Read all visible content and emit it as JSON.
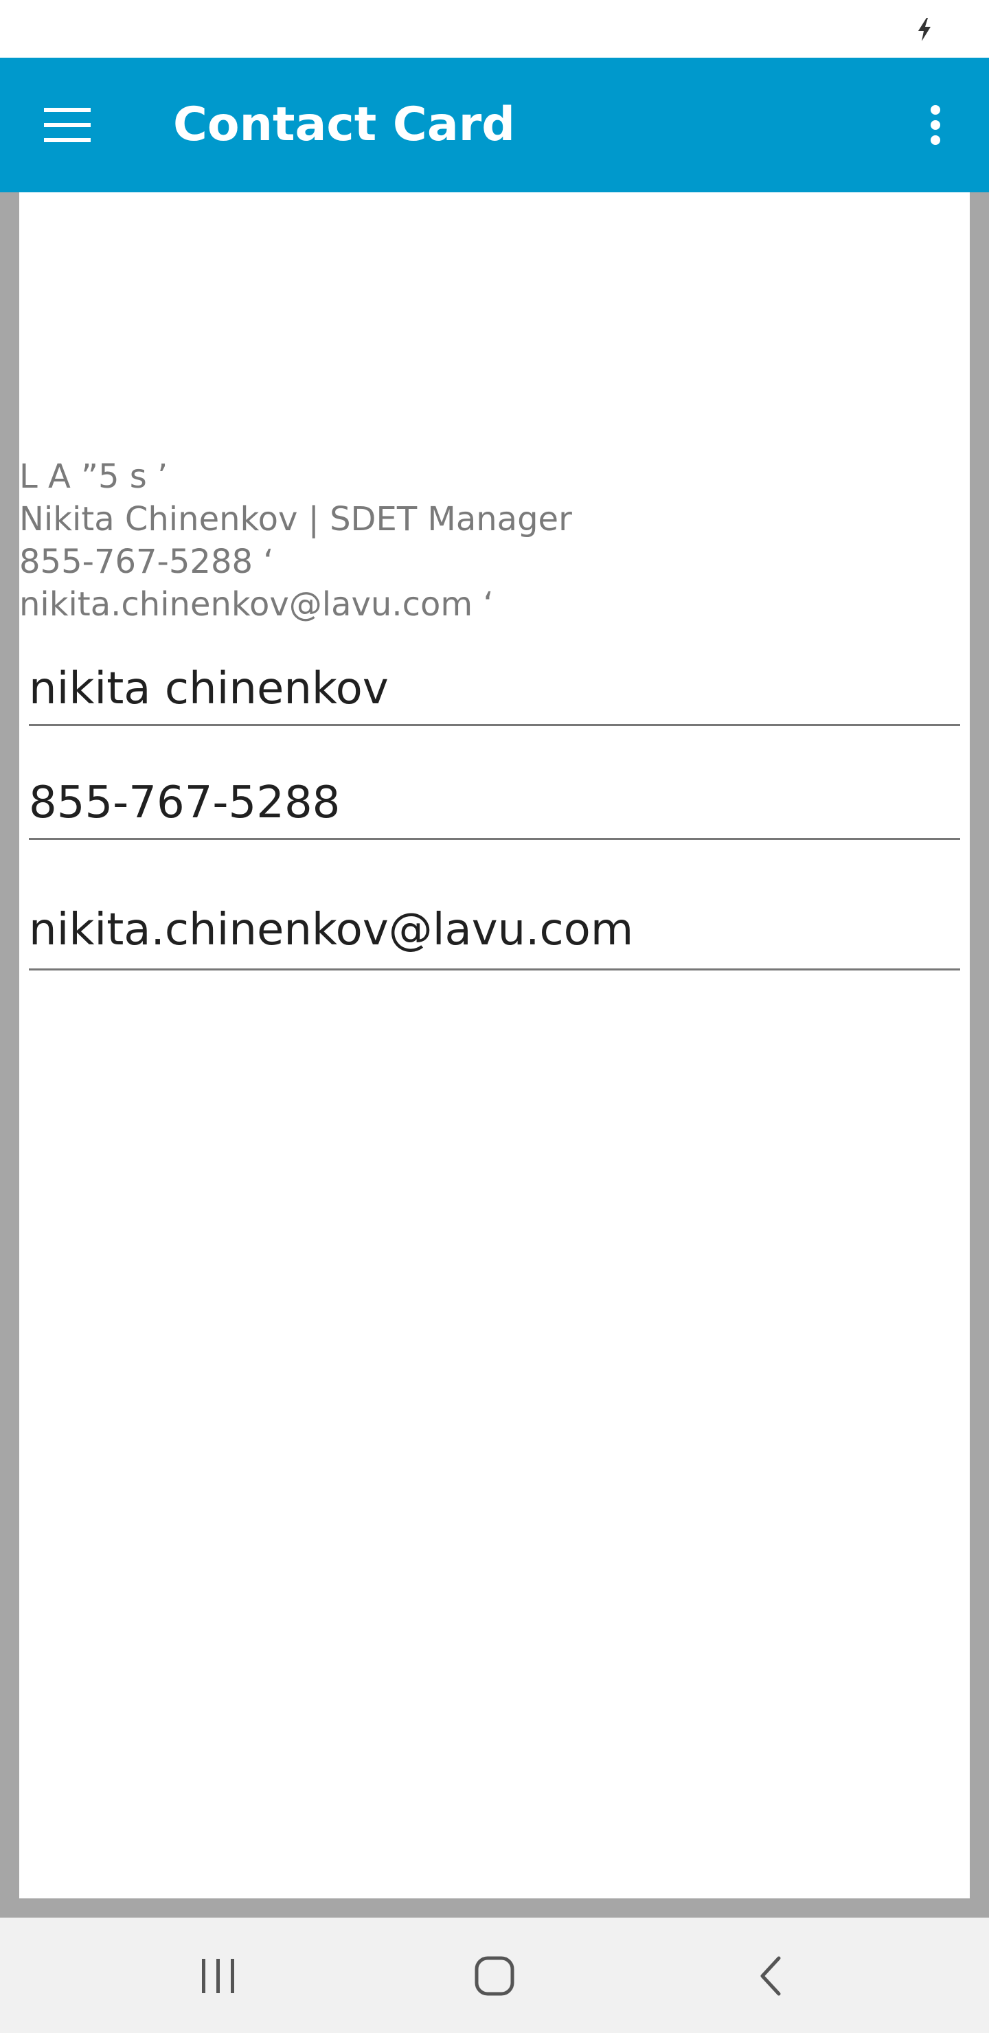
{
  "status_bar": {
    "icons": [
      "charging-icon"
    ]
  },
  "app_bar": {
    "title": "Contact Card",
    "background_color": "#0099cc",
    "icons": [
      "hamburger-menu-icon",
      "overflow-menu-icon"
    ]
  },
  "signature": {
    "lines": [
      "L A ”5 s ’",
      "Nikita Chinenkov | SDET Manager",
      "855-767-5288 ‘",
      "nikita.chinenkov@lavu.com ‘"
    ]
  },
  "form": {
    "name_value": "nikita chinenkov",
    "phone_value": "855-767-5288",
    "email_value": "nikita.chinenkov@lavu.com"
  },
  "nav_bar": {
    "icons": [
      "recent-apps-icon",
      "home-icon",
      "back-icon"
    ]
  }
}
